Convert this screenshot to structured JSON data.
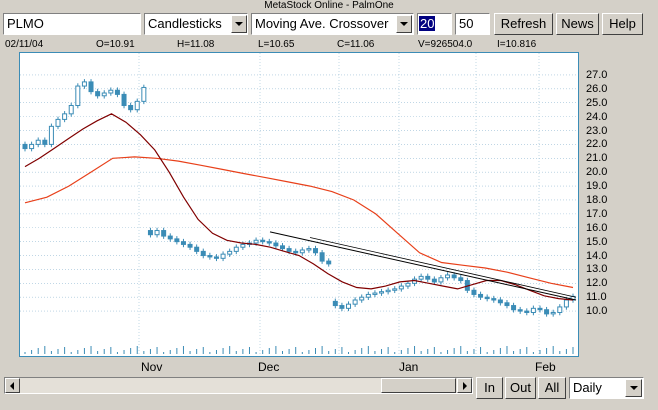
{
  "window": {
    "title": "MetaStock Online - PalmOne"
  },
  "toolbar": {
    "symbol": "PLMO",
    "chart_type": "Candlesticks",
    "indicator": "Moving Ave. Crossover",
    "period1": "20",
    "period2": "50",
    "refresh_label": "Refresh",
    "news_label": "News",
    "help_label": "Help"
  },
  "quote": {
    "date": "02/11/04",
    "open": "O=10.91",
    "high": "H=11.08",
    "low": "L=10.65",
    "close": "C=11.06",
    "volume": "V=926504.0",
    "indicator": "I=10.816"
  },
  "bottom": {
    "zoom_in_label": "In",
    "zoom_out_label": "Out",
    "all_label": "All",
    "interval": "Daily"
  },
  "colors": {
    "chart_border": "#3b8cb6",
    "candle": "#3b8cb6",
    "ma_short": "#800000",
    "ma_long": "#e8401a",
    "trendline": "#000000"
  },
  "chart_data": {
    "type": "line",
    "y_ticks": [
      "27.0",
      "26.0",
      "25.0",
      "24.0",
      "23.0",
      "22.0",
      "21.0",
      "20.0",
      "19.0",
      "18.0",
      "17.0",
      "16.0",
      "15.0",
      "14.0",
      "13.0",
      "12.0",
      "11.0",
      "10.0"
    ],
    "x_ticks": [
      "Nov",
      "Dec",
      "Jan",
      "Feb"
    ],
    "ylim": [
      9.0,
      27.5
    ],
    "close_series": [
      21.7,
      22.0,
      22.3,
      22.0,
      23.3,
      23.8,
      24.2,
      24.8,
      26.2,
      26.5,
      25.8,
      25.5,
      25.7,
      25.9,
      25.6,
      24.8,
      24.5,
      25.1,
      26.1,
      15.5,
      15.8,
      15.4,
      15.2,
      15.0,
      14.8,
      14.6,
      14.3,
      14.0,
      13.9,
      13.8,
      14.1,
      14.3,
      14.6,
      14.8,
      14.9,
      15.1,
      15.0,
      14.9,
      14.7,
      14.5,
      14.3,
      14.2,
      14.4,
      14.5,
      14.2,
      13.6,
      13.4,
      10.4,
      10.2,
      10.5,
      10.8,
      11.0,
      11.2,
      11.3,
      11.4,
      11.5,
      11.6,
      11.8,
      12.0,
      12.3,
      12.5,
      12.3,
      12.1,
      12.4,
      12.6,
      12.4,
      12.2,
      11.5,
      11.2,
      11.0,
      10.9,
      10.8,
      10.6,
      10.4,
      10.1,
      10.0,
      9.9,
      10.2,
      10.1,
      9.8,
      9.9,
      10.3,
      10.8,
      11.06
    ],
    "ma20": [
      20.4,
      21.0,
      21.7,
      22.4,
      23.1,
      23.7,
      24.2,
      23.6,
      22.7,
      21.6,
      20.0,
      18.2,
      16.6,
      15.6,
      15.1,
      14.9,
      14.8,
      14.6,
      14.3,
      14.0,
      13.4,
      12.7,
      12.1,
      11.7,
      11.6,
      11.8,
      12.1,
      12.2,
      12.0,
      11.8,
      11.6,
      11.9,
      12.2,
      12.2,
      11.9,
      11.5,
      11.1,
      10.9,
      10.8
    ],
    "ma50": [
      17.8,
      18.2,
      19.0,
      20.0,
      21.0,
      21.1,
      21.0,
      20.8,
      20.5,
      20.2,
      19.9,
      19.6,
      19.3,
      19.0,
      18.6,
      18.0,
      17.0,
      15.6,
      14.2,
      13.5,
      13.3,
      13.1,
      12.8,
      12.4,
      12.0,
      11.7
    ],
    "volume": "926504.0"
  }
}
